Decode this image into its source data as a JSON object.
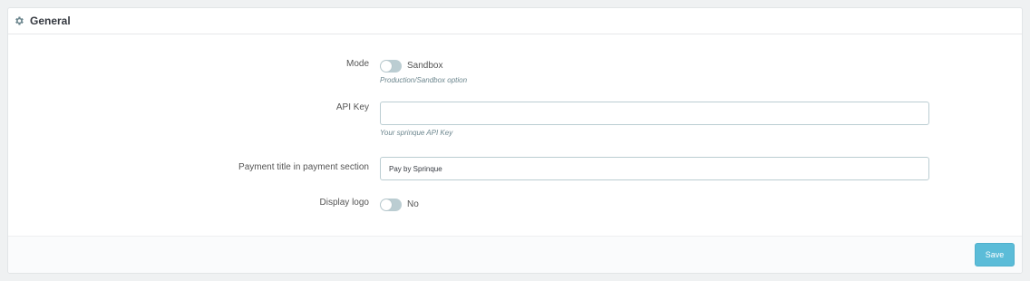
{
  "panel": {
    "title": "General",
    "icon": "gear-icon"
  },
  "form": {
    "mode": {
      "label": "Mode",
      "value_label": "Sandbox",
      "enabled": false,
      "help": "Production/Sandbox option"
    },
    "api_key": {
      "label": "API Key",
      "value": "",
      "placeholder": "",
      "help": "Your sprinque API Key"
    },
    "payment_title": {
      "label": "Payment title in payment section",
      "value": "Pay by Sprinque"
    },
    "display_logo": {
      "label": "Display logo",
      "value_label": "No",
      "enabled": false
    }
  },
  "footer": {
    "save_label": "Save"
  },
  "colors": {
    "accent": "#5bbcd8",
    "switch_off": "#bbcdd2",
    "help_text": "#6c868e"
  }
}
